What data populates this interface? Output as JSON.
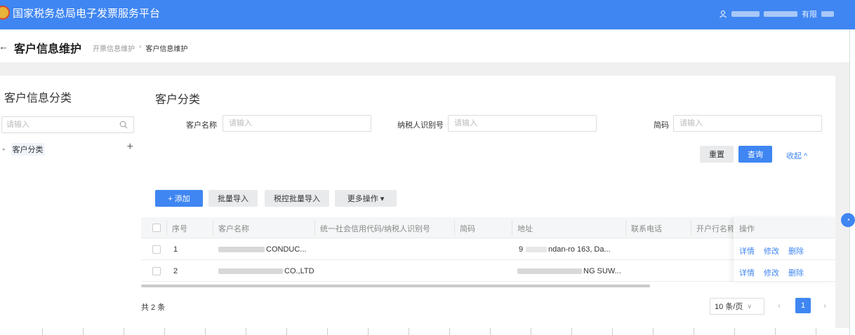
{
  "header": {
    "app_title": "国家税务总局电子发票服务平台",
    "user_suffix": "有限"
  },
  "breadcrumb": {
    "back_icon": "back-arrow-icon",
    "page_title": "客户信息维护",
    "parent": "开票信息维护",
    "separator": "›",
    "current": "客户信息维护"
  },
  "left_panel": {
    "title": "客户信息分类",
    "search_placeholder": "请输入",
    "tree": [
      {
        "label": "客户分类",
        "add_label": "+"
      }
    ]
  },
  "main": {
    "title": "客户分类",
    "filters": {
      "customer_name": {
        "label": "客户名称",
        "placeholder": "请输入"
      },
      "taxpayer_id": {
        "label": "纳税人识别号",
        "placeholder": "请输入"
      },
      "short_code": {
        "label": "简码",
        "placeholder": "请输入"
      }
    },
    "buttons": {
      "reset": "重置",
      "query": "查询",
      "collapse": "收起 ^",
      "add": "+ 添加",
      "batch_import": "批量导入",
      "tax_batch_import": "税控批量导入",
      "more_actions": "更多操作 ▾"
    },
    "table": {
      "columns": [
        "序号",
        "客户名称",
        "统一社会信用代码/纳税人识别号",
        "简码",
        "地址",
        "联系电话",
        "开户行名称",
        "操作"
      ],
      "rows": [
        {
          "index": "1",
          "name": "CONDUC...",
          "address": "9",
          "address_tail": "ndan-ro 163, Da..."
        },
        {
          "index": "2",
          "name": "CO.,LTD",
          "address": "",
          "address_tail": "NG SUW..."
        }
      ],
      "actions": {
        "detail": "详情",
        "edit": "修改",
        "delete": "删除"
      }
    },
    "pagination": {
      "total": "共 2 条",
      "page_size": "10 条/页",
      "current_page": "1",
      "prev": "‹",
      "next": "›"
    }
  },
  "colors": {
    "primary": "#3f86f2",
    "header_bg": "#3f86f2",
    "page_bg": "#f0f0f0"
  }
}
